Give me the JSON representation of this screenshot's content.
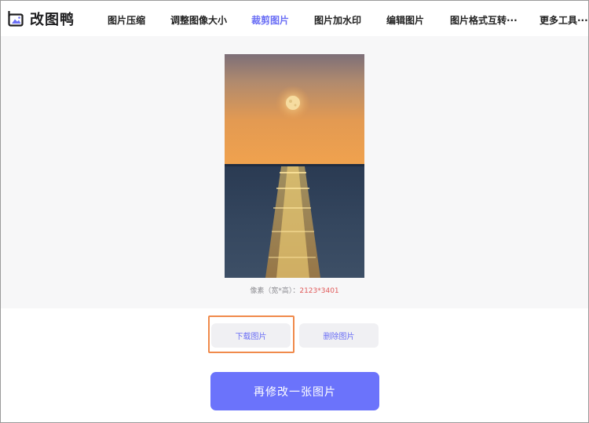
{
  "brand": {
    "name": "改图鸭",
    "logo_icon": "image-icon",
    "accent_color": "#6b6ff5"
  },
  "nav": {
    "items": [
      {
        "label": "图片压缩",
        "active": false
      },
      {
        "label": "调整图像大小",
        "active": false
      },
      {
        "label": "裁剪图片",
        "active": true
      },
      {
        "label": "图片加水印",
        "active": false
      },
      {
        "label": "编辑图片",
        "active": false
      },
      {
        "label": "图片格式互转···",
        "active": false
      },
      {
        "label": "更多工具···",
        "active": false
      }
    ]
  },
  "preview": {
    "image_icon": "sunset-sea-photo",
    "dims_label": "像素（宽*高）：",
    "dims_value": "2123*3401"
  },
  "actions": {
    "download_label": "下载图片",
    "delete_label": "删除图片",
    "modify_again_label": "再修改一张图片"
  }
}
